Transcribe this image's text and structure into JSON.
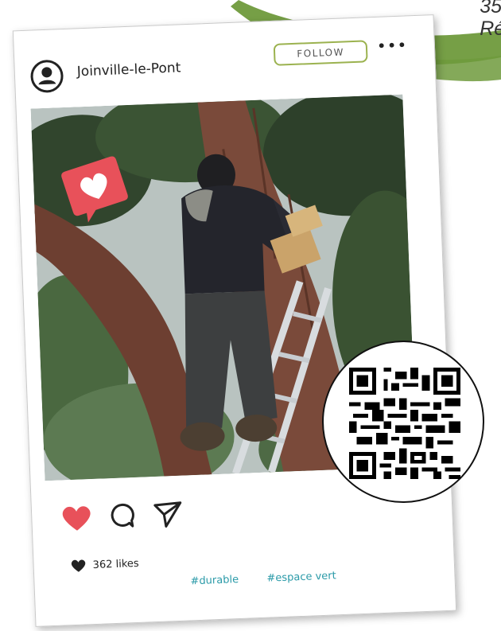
{
  "header_text": {
    "line1": "35,",
    "line2": "Ré"
  },
  "post": {
    "username": "Joinville-le-Pont",
    "follow_label": "FOLLOW",
    "likes_label": "362 likes",
    "hashtags": [
      "#durable",
      "#espace vert"
    ]
  },
  "colors": {
    "accent_green": "#9bb24f",
    "swoosh_green": "#6f9a3c",
    "heart_red": "#e8515a",
    "hashtag_teal": "#2a9aa8"
  },
  "icons": {
    "avatar": "user-circle-icon",
    "more": "ellipsis-icon",
    "like": "heart-icon",
    "comment": "comment-bubble-icon",
    "share": "paper-plane-icon",
    "likes": "heart-small-icon",
    "badge": "heart-notification-icon",
    "qr": "qr-code-icon"
  }
}
